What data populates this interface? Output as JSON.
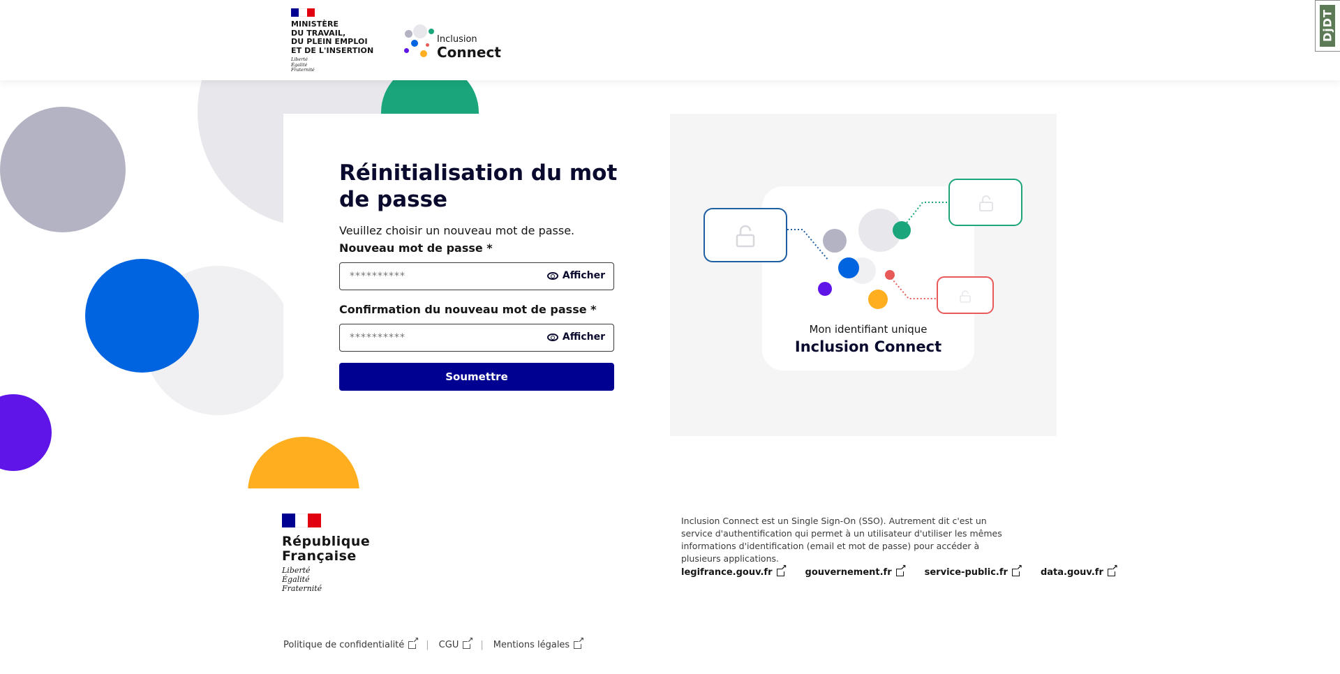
{
  "header": {
    "ministry_lines": "Ministère\ndu travail,\ndu plein emploi\net de l'insertion",
    "ministry_motto": "Liberté\nÉgalité\nFraternité",
    "app_logo_line1": "Inclusion",
    "app_logo_line2": "Connect",
    "debug_toolbar_label": "DjDT"
  },
  "form": {
    "title": "Réinitialisation du mot de passe",
    "intro": "Veuillez choisir un nouveau mot de passe.",
    "new_password_label": "Nouveau mot de passe *",
    "new_password_placeholder": "**********",
    "confirm_password_label": "Confirmation du nouveau mot de passe *",
    "confirm_password_placeholder": "**********",
    "show_label": "Afficher",
    "submit_label": "Soumettre"
  },
  "illustration": {
    "caption_line1": "Mon identifiant unique",
    "caption_line2": "Inclusion Connect"
  },
  "footer": {
    "republic_name": "République\nFrançaise",
    "republic_motto": "Liberté\nÉgalité\nFraternité",
    "description": "Inclusion Connect est un Single Sign-On (SSO). Autrement dit c'est un service d'authentification qui permet à un utilisateur d'utiliser les mêmes informations d'identification (email et mot de passe) pour accéder à plusieurs applications.",
    "links": [
      "legifrance.gouv.fr",
      "gouvernement.fr",
      "service-public.fr",
      "data.gouv.fr"
    ],
    "bottom_links": [
      "Politique de confidentialité",
      "CGU",
      "Mentions légales"
    ]
  },
  "colors": {
    "primary": "#000091",
    "green": "#1aa57a",
    "blue": "#0064e0",
    "purple": "#6015e8",
    "orange": "#ffae1f",
    "grey": "#b3b3c3",
    "light_grey": "#e8e8ec",
    "red": "#e85a5a"
  }
}
